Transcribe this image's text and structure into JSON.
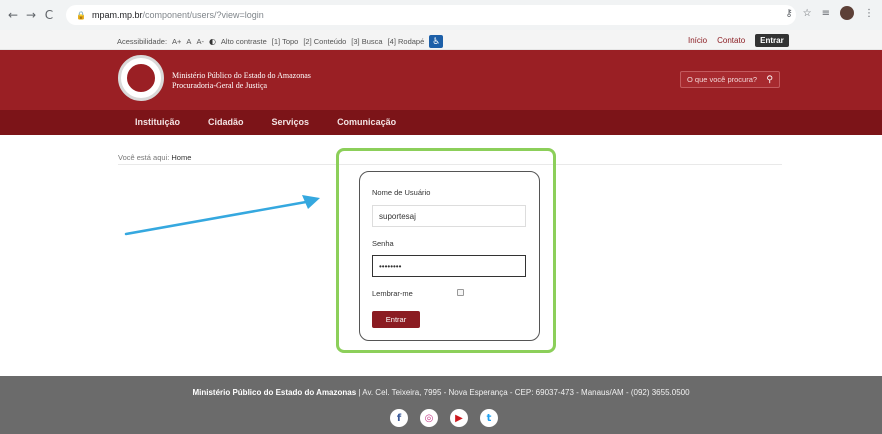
{
  "browser": {
    "back": "←",
    "forward": "→",
    "reload": "C",
    "url_host": "mpam.mp.br",
    "url_path": "/component/users/?view=login"
  },
  "topbar": {
    "acc_label": "Acessibilidade:",
    "font_plus": "A+",
    "font_normal": "A",
    "font_minus": "A-",
    "contrast": "Alto contraste",
    "skip_top": "[1] Topo",
    "skip_content": "[2] Conteúdo",
    "skip_search": "[3] Busca",
    "skip_footer": "[4] Rodapé",
    "home": "Início",
    "contact": "Contato",
    "login": "Entrar"
  },
  "header": {
    "org_line1": "Ministério Público do Estado do Amazonas",
    "org_line2": "Procuradoria-Geral de Justiça",
    "search_placeholder": "O que você procura?"
  },
  "nav": {
    "items": [
      "Instituição",
      "Cidadão",
      "Serviços",
      "Comunicação"
    ]
  },
  "breadcrumb": {
    "prefix": "Você está aqui:",
    "home": "Home"
  },
  "form": {
    "username_label": "Nome de Usuário",
    "username_value": "suportesaj",
    "password_label": "Senha",
    "password_value": "••••••••",
    "remember_label": "Lembrar-me",
    "submit_label": "Entrar"
  },
  "footer": {
    "org": "Ministério Público do Estado do Amazonas",
    "address": " | Av. Cel. Teixeira, 7995 - Nova Esperança - CEP: 69037-473 - Manaus/AM - (092) 3655.0500",
    "facebook": "f",
    "instagram": "◎",
    "youtube": "▶",
    "twitter": "t"
  },
  "colors": {
    "brand": "#9a1f24",
    "nav": "#7c1418",
    "highlight": "#8ccf5a",
    "footer": "#6b6b6b"
  }
}
